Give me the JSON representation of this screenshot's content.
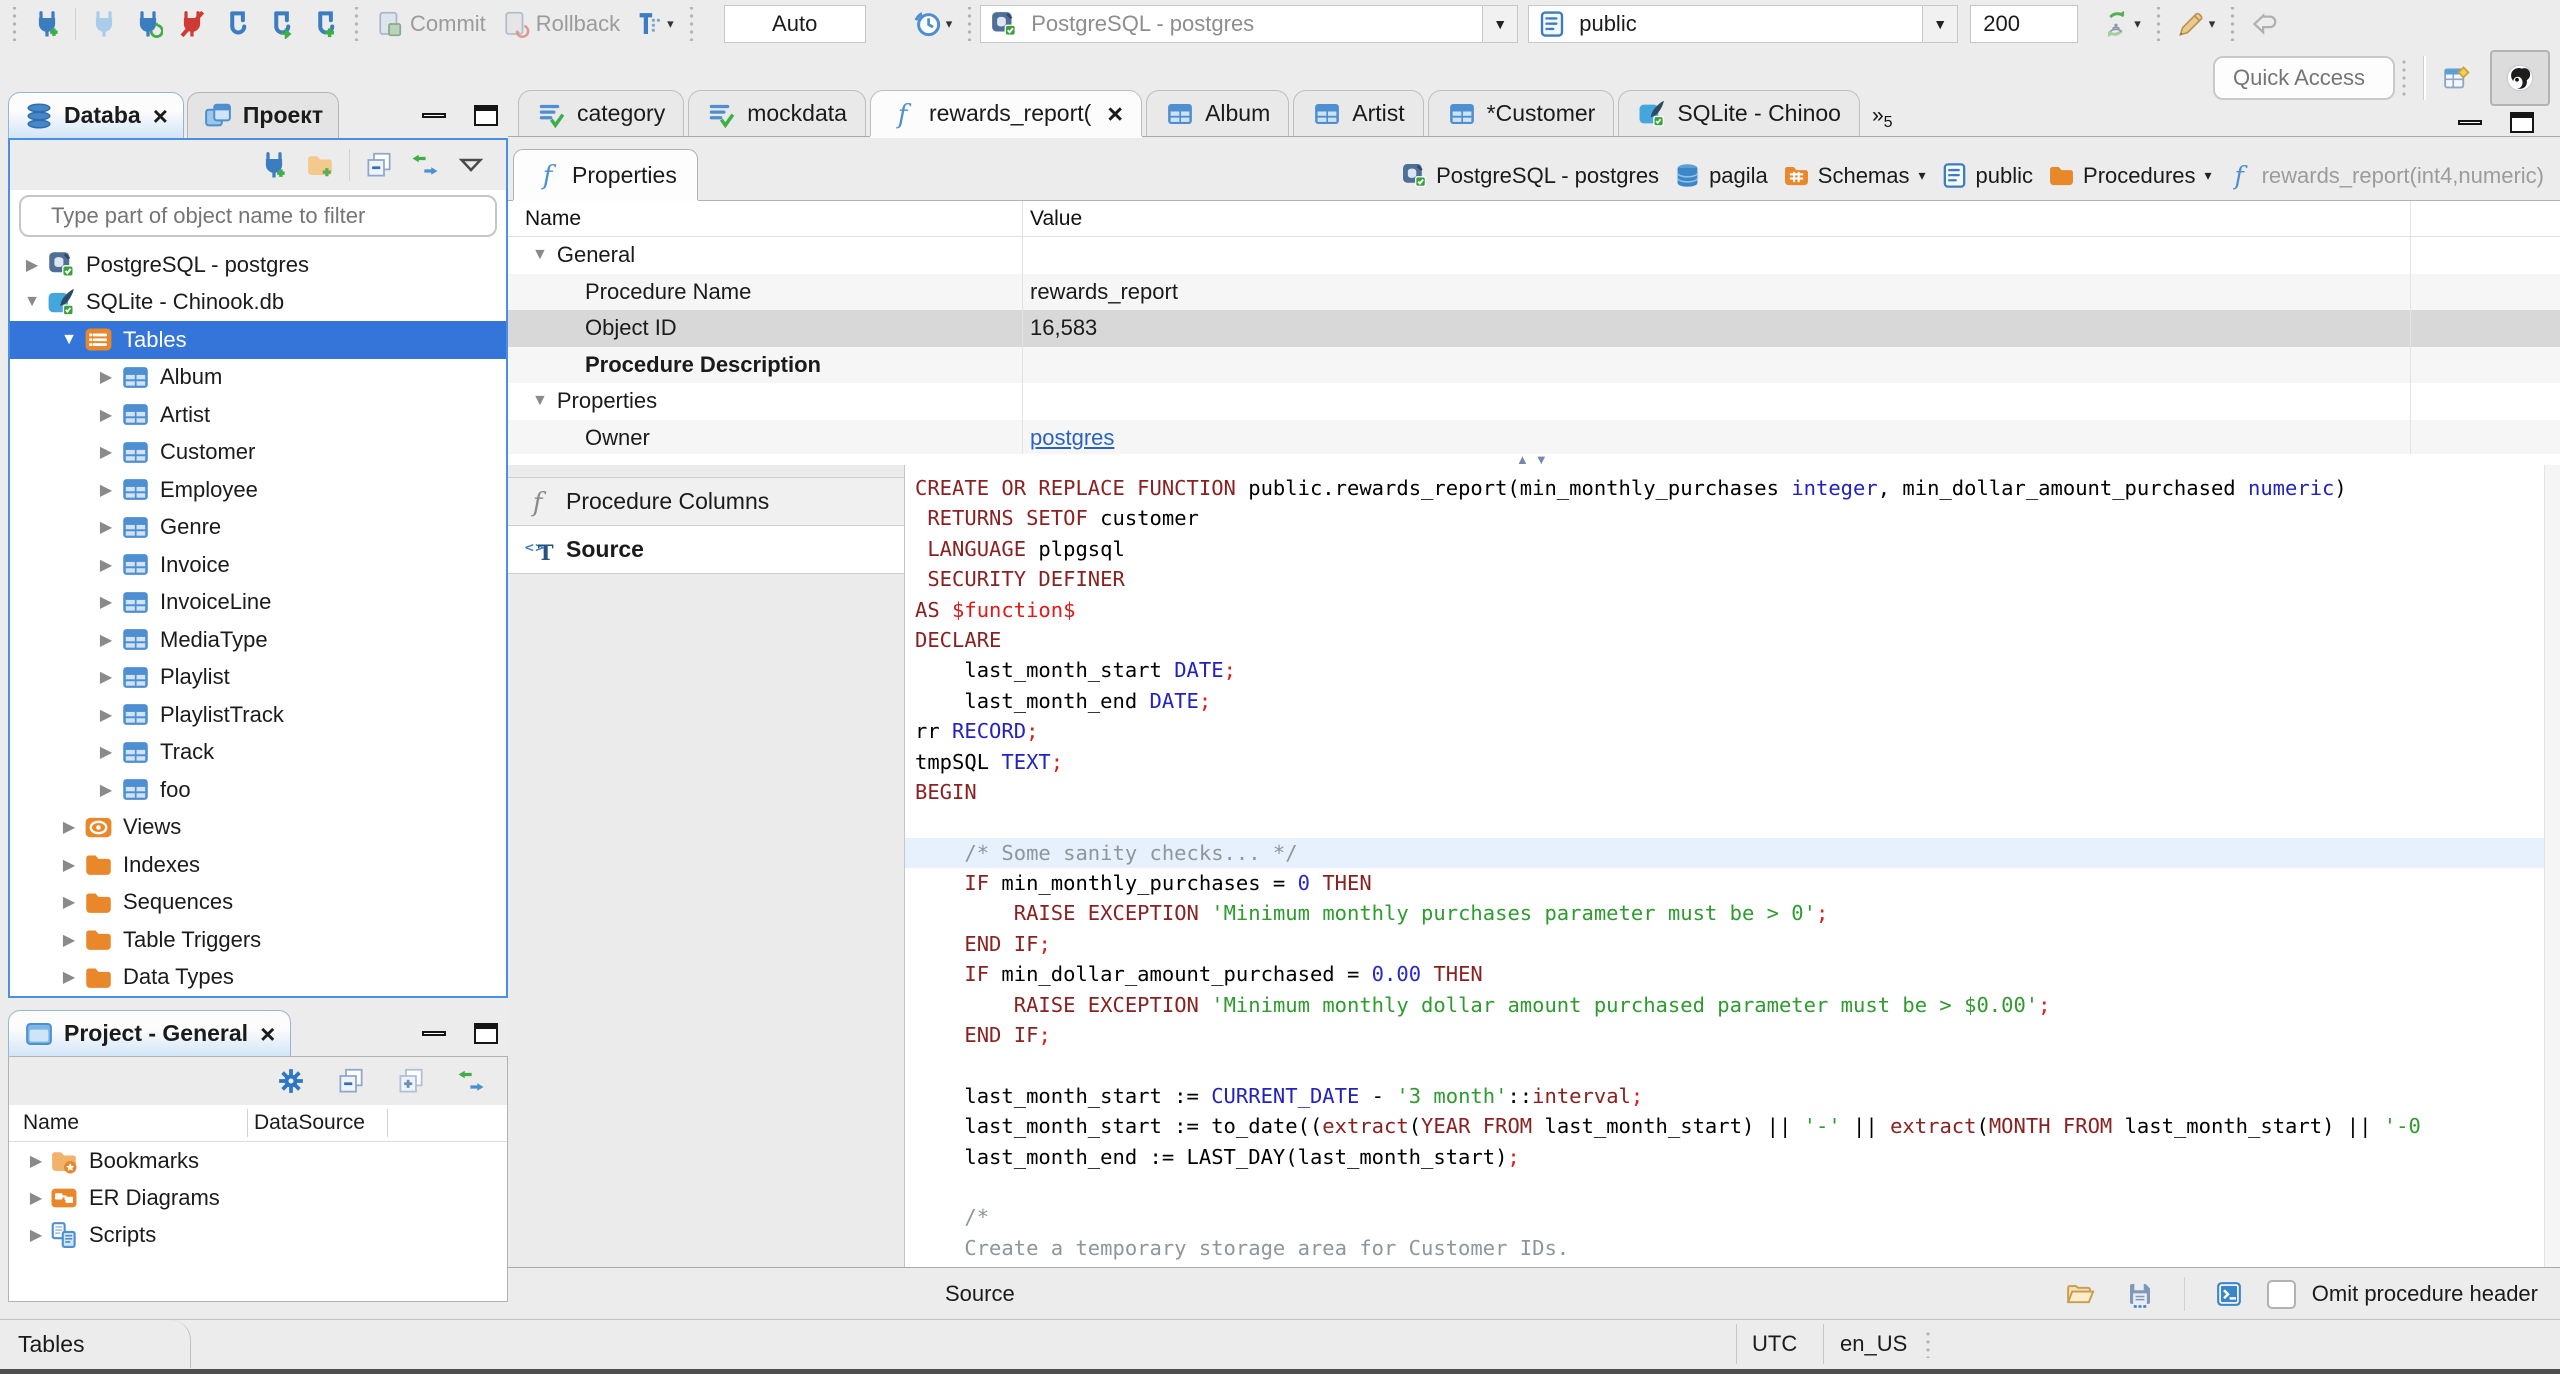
{
  "colors": {
    "selection_blue": "#3574d9",
    "focus_border_blue": "#4a90e2",
    "active_tab_tint": "#d2e5f8",
    "link_blue": "#2a62c4",
    "folder_orange": "#e8882b",
    "code_keyword": "#8a2121",
    "code_type": "#2222c2",
    "code_string": "#2e9b2e",
    "code_number": "#2727cd",
    "code_punctuation": "#e01919",
    "code_comment": "#8d969c",
    "current_line_highlight": "#e7f1fd"
  },
  "toolbar": {
    "commit_label": "Commit",
    "rollback_label": "Rollback",
    "auto_label": "Auto",
    "connection_value": "PostgreSQL - postgres",
    "schema_value": "public",
    "fetch_size": "200"
  },
  "quick_access": {
    "placeholder": "Quick Access"
  },
  "sidebar": {
    "tabs": [
      {
        "label": "Databa",
        "icon": "navdb",
        "active": true,
        "closable": true
      },
      {
        "label": "Проект",
        "icon": "projects"
      }
    ],
    "filter_placeholder": "Type part of object name to filter",
    "tree": [
      {
        "label": "PostgreSQL - postgres",
        "icon": "postgres",
        "level": 0,
        "expander": "collapsed"
      },
      {
        "label": "SQLite - Chinook.db",
        "icon": "sqlite",
        "level": 0,
        "expander": "expanded"
      },
      {
        "label": "Tables",
        "icon": "tables-folder",
        "level": 1,
        "expander": "expanded",
        "selected": true
      },
      {
        "label": "Album",
        "icon": "table",
        "level": 2,
        "expander": "collapsed"
      },
      {
        "label": "Artist",
        "icon": "table",
        "level": 2,
        "expander": "collapsed"
      },
      {
        "label": "Customer",
        "icon": "table",
        "level": 2,
        "expander": "collapsed"
      },
      {
        "label": "Employee",
        "icon": "table",
        "level": 2,
        "expander": "collapsed"
      },
      {
        "label": "Genre",
        "icon": "table",
        "level": 2,
        "expander": "collapsed"
      },
      {
        "label": "Invoice",
        "icon": "table",
        "level": 2,
        "expander": "collapsed"
      },
      {
        "label": "InvoiceLine",
        "icon": "table",
        "level": 2,
        "expander": "collapsed"
      },
      {
        "label": "MediaType",
        "icon": "table",
        "level": 2,
        "expander": "collapsed"
      },
      {
        "label": "Playlist",
        "icon": "table",
        "level": 2,
        "expander": "collapsed"
      },
      {
        "label": "PlaylistTrack",
        "icon": "table",
        "level": 2,
        "expander": "collapsed"
      },
      {
        "label": "Track",
        "icon": "table",
        "level": 2,
        "expander": "collapsed"
      },
      {
        "label": "foo",
        "icon": "table",
        "level": 2,
        "expander": "collapsed"
      },
      {
        "label": "Views",
        "icon": "views",
        "level": 1,
        "expander": "collapsed"
      },
      {
        "label": "Indexes",
        "icon": "folder",
        "level": 1,
        "expander": "collapsed"
      },
      {
        "label": "Sequences",
        "icon": "folder",
        "level": 1,
        "expander": "collapsed"
      },
      {
        "label": "Table Triggers",
        "icon": "folder",
        "level": 1,
        "expander": "collapsed"
      },
      {
        "label": "Data Types",
        "icon": "folder",
        "level": 1,
        "expander": "collapsed"
      }
    ]
  },
  "project_panel": {
    "title": "Project - General",
    "columns": [
      "Name",
      "DataSource"
    ],
    "items": [
      {
        "label": "Bookmarks",
        "icon": "bookmarks"
      },
      {
        "label": "ER Diagrams",
        "icon": "erd"
      },
      {
        "label": "Scripts",
        "icon": "scripts"
      }
    ]
  },
  "editor": {
    "tabs": [
      {
        "label": "category",
        "icon": "sql-file"
      },
      {
        "label": "mockdata",
        "icon": "sql-file"
      },
      {
        "label": "rewards_report(",
        "icon": "function",
        "active": true,
        "closable": true
      },
      {
        "label": "Album",
        "icon": "table"
      },
      {
        "label": "Artist",
        "icon": "table"
      },
      {
        "label": "*Customer",
        "icon": "table"
      },
      {
        "label": "SQLite - Chinoo",
        "icon": "sqlite"
      }
    ],
    "overflow_count": "5",
    "properties_tab": "Properties",
    "breadcrumb": [
      {
        "label": "PostgreSQL - postgres",
        "icon": "postgres"
      },
      {
        "label": "pagila",
        "icon": "database"
      },
      {
        "label": "Schemas",
        "icon": "schemas-folder",
        "dropdown": true
      },
      {
        "label": "public",
        "icon": "schema-card"
      },
      {
        "label": "Procedures",
        "icon": "folder",
        "dropdown": true
      },
      {
        "label": "rewards_report(int4,numeric)",
        "icon": "function",
        "dim": true
      }
    ],
    "subnav": [
      {
        "label": "Procedure Columns",
        "icon": "function-gray"
      },
      {
        "label": "Source",
        "icon": "source",
        "active": true
      }
    ],
    "footer": {
      "label": "Source",
      "omit_label": "Omit procedure header"
    }
  },
  "properties_grid": {
    "columns": [
      "Name",
      "Value"
    ],
    "rows": [
      {
        "name": "General",
        "group": true
      },
      {
        "name": "Procedure Name",
        "value": "rewards_report",
        "shade": true
      },
      {
        "name": "Object ID",
        "value": "16,583",
        "selected": true
      },
      {
        "name": "Procedure Description",
        "bold": true,
        "shade": true
      },
      {
        "name": "Properties",
        "group": true
      },
      {
        "name": "Owner",
        "value": "postgres",
        "link": true,
        "shade": true
      }
    ]
  },
  "source_editor": {
    "lines": [
      {
        "seg": [
          [
            "k",
            "CREATE OR REPLACE FUNCTION"
          ],
          [
            "d",
            " public.rewards_report(min_monthly_purchases "
          ],
          [
            "t",
            "integer"
          ],
          [
            "d",
            ", min_dollar_amount_purchased "
          ],
          [
            "t",
            "numeric"
          ],
          [
            "d",
            ")"
          ]
        ]
      },
      {
        "seg": [
          [
            "d",
            " "
          ],
          [
            "k",
            "RETURNS SETOF"
          ],
          [
            "d",
            " customer"
          ]
        ]
      },
      {
        "seg": [
          [
            "d",
            " "
          ],
          [
            "k",
            "LANGUAGE"
          ],
          [
            "d",
            " plpgsql"
          ]
        ]
      },
      {
        "seg": [
          [
            "d",
            " "
          ],
          [
            "k",
            "SECURITY DEFINER"
          ]
        ]
      },
      {
        "seg": [
          [
            "k",
            "AS"
          ],
          [
            "p",
            " $function$"
          ]
        ]
      },
      {
        "seg": [
          [
            "k",
            "DECLARE"
          ]
        ]
      },
      {
        "seg": [
          [
            "d",
            "    last_month_start "
          ],
          [
            "t",
            "DATE"
          ],
          [
            "p",
            ";"
          ]
        ]
      },
      {
        "seg": [
          [
            "d",
            "    last_month_end "
          ],
          [
            "t",
            "DATE"
          ],
          [
            "p",
            ";"
          ]
        ]
      },
      {
        "seg": [
          [
            "d",
            "rr "
          ],
          [
            "t",
            "RECORD"
          ],
          [
            "p",
            ";"
          ]
        ]
      },
      {
        "seg": [
          [
            "d",
            "tmpSQL "
          ],
          [
            "t",
            "TEXT"
          ],
          [
            "p",
            ";"
          ]
        ]
      },
      {
        "seg": [
          [
            "k",
            "BEGIN"
          ]
        ]
      },
      {
        "seg": []
      },
      {
        "hl": true,
        "seg": [
          [
            "c",
            "    /* Some sanity checks... */"
          ]
        ]
      },
      {
        "seg": [
          [
            "d",
            "    "
          ],
          [
            "k",
            "IF"
          ],
          [
            "d",
            " min_monthly_purchases = "
          ],
          [
            "n",
            "0"
          ],
          [
            "d",
            " "
          ],
          [
            "k",
            "THEN"
          ]
        ]
      },
      {
        "seg": [
          [
            "d",
            "        "
          ],
          [
            "k",
            "RAISE EXCEPTION"
          ],
          [
            "d",
            " "
          ],
          [
            "s",
            "'Minimum monthly purchases parameter must be > 0'"
          ],
          [
            "p",
            ";"
          ]
        ]
      },
      {
        "seg": [
          [
            "d",
            "    "
          ],
          [
            "k",
            "END IF"
          ],
          [
            "p",
            ";"
          ]
        ]
      },
      {
        "seg": [
          [
            "d",
            "    "
          ],
          [
            "k",
            "IF"
          ],
          [
            "d",
            " min_dollar_amount_purchased = "
          ],
          [
            "n",
            "0.00"
          ],
          [
            "d",
            " "
          ],
          [
            "k",
            "THEN"
          ]
        ]
      },
      {
        "seg": [
          [
            "d",
            "        "
          ],
          [
            "k",
            "RAISE EXCEPTION"
          ],
          [
            "d",
            " "
          ],
          [
            "s",
            "'Minimum monthly dollar amount purchased parameter must be > $0.00'"
          ],
          [
            "p",
            ";"
          ]
        ]
      },
      {
        "seg": [
          [
            "d",
            "    "
          ],
          [
            "k",
            "END IF"
          ],
          [
            "p",
            ";"
          ]
        ]
      },
      {
        "seg": []
      },
      {
        "seg": [
          [
            "d",
            "    last_month_start := "
          ],
          [
            "t",
            "CURRENT_DATE"
          ],
          [
            "d",
            " - "
          ],
          [
            "s",
            "'3 month'"
          ],
          [
            "d",
            "::"
          ],
          [
            "k",
            "interval"
          ],
          [
            "p",
            ";"
          ]
        ]
      },
      {
        "seg": [
          [
            "d",
            "    last_month_start := to_date(("
          ],
          [
            "k",
            "extract"
          ],
          [
            "d",
            "("
          ],
          [
            "k",
            "YEAR FROM"
          ],
          [
            "d",
            " last_month_start) || "
          ],
          [
            "s",
            "'-'"
          ],
          [
            "d",
            " || "
          ],
          [
            "k",
            "extract"
          ],
          [
            "d",
            "("
          ],
          [
            "k",
            "MONTH FROM"
          ],
          [
            "d",
            " last_month_start) || "
          ],
          [
            "s",
            "'-0"
          ]
        ]
      },
      {
        "seg": [
          [
            "d",
            "    last_month_end := LAST_DAY(last_month_start)"
          ],
          [
            "p",
            ";"
          ]
        ]
      },
      {
        "seg": []
      },
      {
        "seg": [
          [
            "c",
            "    /*"
          ]
        ]
      },
      {
        "seg": [
          [
            "c",
            "    Create a temporary storage area for Customer IDs."
          ]
        ]
      },
      {
        "seg": [
          [
            "c",
            "    */"
          ]
        ]
      }
    ]
  },
  "status_bar": {
    "left": "Tables",
    "timezone": "UTC",
    "locale": "en_US"
  }
}
